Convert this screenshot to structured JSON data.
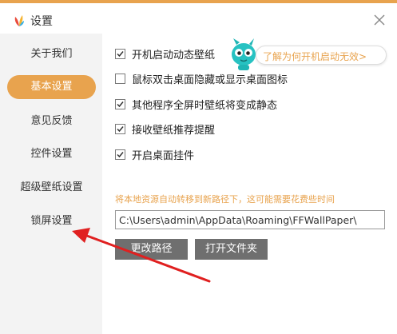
{
  "window": {
    "title": "设置",
    "accent_color": "#e8a34e"
  },
  "sidebar": {
    "items": [
      {
        "label": "关于我们",
        "active": false
      },
      {
        "label": "基本设置",
        "active": true
      },
      {
        "label": "意见反馈",
        "active": false
      },
      {
        "label": "控件设置",
        "active": false
      },
      {
        "label": "超级壁纸设置",
        "active": false
      },
      {
        "label": "锁屏设置",
        "active": false
      }
    ]
  },
  "options": [
    {
      "label": "开机启动动态壁纸",
      "checked": true
    },
    {
      "label": "鼠标双击桌面隐藏或显示桌面图标",
      "checked": false
    },
    {
      "label": "其他程序全屏时壁纸将变成静态",
      "checked": true
    },
    {
      "label": "接收壁纸推荐提醒",
      "checked": true
    },
    {
      "label": "开启桌面挂件",
      "checked": true
    }
  ],
  "tip": {
    "text": "了解为何开机启动无效>",
    "icon": "mascot-icon"
  },
  "storage": {
    "notice": "将本地资源自动转移到新路径下，这可能需要花费些时间",
    "path_value": "C:\\Users\\admin\\AppData\\Roaming\\FFWallPaper\\",
    "change_button": "更改路径",
    "open_button": "打开文件夹"
  },
  "annotation": {
    "arrow_color": "#e02020"
  }
}
